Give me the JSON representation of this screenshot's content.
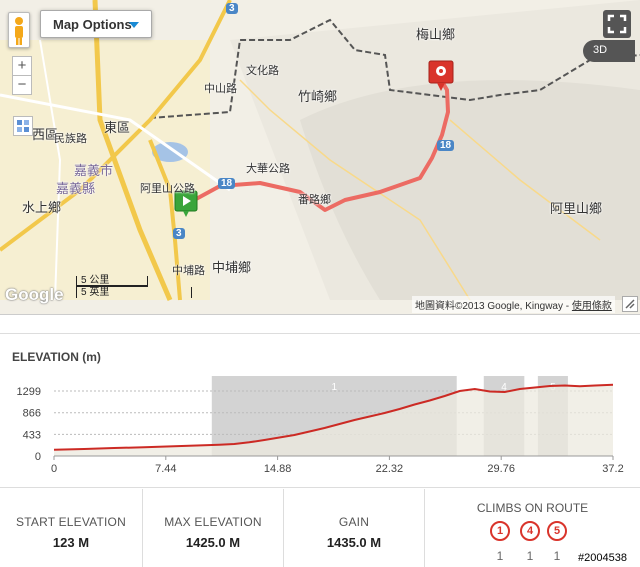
{
  "map": {
    "options_label": "Map Options",
    "btn3d_label": "3D",
    "labels": {
      "meishan": "梅山鄉",
      "zhuqi": "竹崎鄉",
      "alishan": "阿里山鄉",
      "zhongpu": "中埔鄉",
      "shuishang": "水上鄉",
      "east": "東區",
      "west": "西區",
      "fanlu": "番路鄉",
      "chiayi_city": "嘉義市",
      "chiayi_county": "嘉義縣",
      "wenhua": "文化路",
      "zhongshan": "中山路",
      "minzu": "民族路",
      "alishan_rd": "阿里山公路",
      "daxue": "大華公路",
      "zhongbu_rd": "中埔路"
    },
    "route_shield_1": "18",
    "route_shield_2": "3",
    "scale_km": "5 公里",
    "scale_mi": "5 英里",
    "logo": "Google",
    "attribution_text": "地圖資料©2013 Google, Kingway - ",
    "attribution_link": "使用條款"
  },
  "elevation": {
    "title": "ELEVATION (m)",
    "y_ticks": [
      "0",
      "433",
      "866",
      "1299"
    ],
    "x_ticks": [
      "0",
      "7.44",
      "14.88",
      "22.32",
      "29.76",
      "37.2"
    ],
    "climb_labels": [
      "1",
      "4",
      "5"
    ]
  },
  "chart_data": {
    "type": "area",
    "title": "ELEVATION (m)",
    "xlabel": "",
    "ylabel": "",
    "xlim": [
      0,
      37.2
    ],
    "ylim": [
      0,
      1600
    ],
    "x": [
      0,
      2,
      4,
      6,
      8,
      10,
      11,
      12,
      13,
      14,
      15,
      16,
      17,
      18,
      19,
      20,
      21,
      22,
      23,
      24,
      25,
      26,
      27,
      28,
      29,
      30,
      31,
      32,
      33,
      34,
      35,
      36,
      37.2
    ],
    "series": [
      {
        "values": [
          123,
          140,
          160,
          175,
          195,
          215,
          225,
          240,
          275,
          320,
          370,
          420,
          490,
          560,
          640,
          720,
          790,
          860,
          940,
          1030,
          1110,
          1200,
          1300,
          1340,
          1290,
          1280,
          1340,
          1370,
          1400,
          1410,
          1395,
          1410,
          1425
        ]
      }
    ],
    "climbs": [
      {
        "label": "1",
        "x_start": 10.5,
        "x_end": 26.8
      },
      {
        "label": "4",
        "x_start": 28.6,
        "x_end": 31.3
      },
      {
        "label": "5",
        "x_start": 32.2,
        "x_end": 34.2
      }
    ],
    "grid": true
  },
  "stats": {
    "start_label": "START ELEVATION",
    "start_value": "123 M",
    "max_label": "MAX ELEVATION",
    "max_value": "1425.0 M",
    "gain_label": "GAIN",
    "gain_value": "1435.0 M",
    "climbs_label": "CLIMBS ON ROUTE",
    "climbs": [
      {
        "cat": "1",
        "count": "1"
      },
      {
        "cat": "4",
        "count": "1"
      },
      {
        "cat": "5",
        "count": "1"
      }
    ]
  },
  "watermark": "#2004538",
  "colors": {
    "route": "#e8726a",
    "profile": "#cc2a24",
    "fill": "#ece9df",
    "climb": "#d3d3d3",
    "accent": "#1a8ad4"
  }
}
